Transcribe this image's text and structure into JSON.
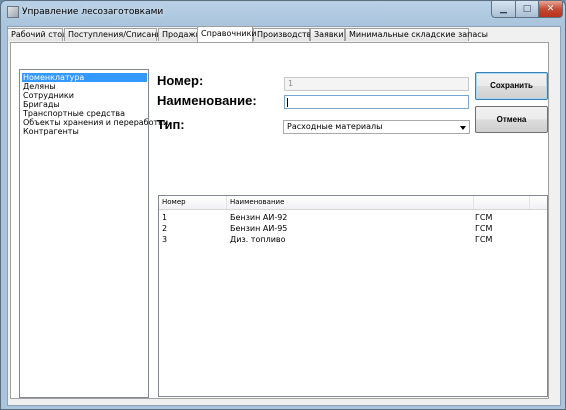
{
  "window": {
    "title": "Управление лесозаготовками",
    "controls": {
      "minimize": "▁",
      "maximize": "□",
      "close": "✕"
    }
  },
  "tabs": [
    {
      "label": "Рабочий стол",
      "active": false
    },
    {
      "label": "Поступления/Списания",
      "active": false
    },
    {
      "label": "Продажи",
      "active": false
    },
    {
      "label": "Справочники",
      "active": true
    },
    {
      "label": "Производство",
      "active": false
    },
    {
      "label": "Заявки",
      "active": false
    },
    {
      "label": "Минимальные складские запасы",
      "active": false
    }
  ],
  "directories": {
    "items": [
      {
        "label": "Номенклатура",
        "selected": true
      },
      {
        "label": "Деляны",
        "selected": false
      },
      {
        "label": "Сотрудники",
        "selected": false
      },
      {
        "label": "Бригады",
        "selected": false
      },
      {
        "label": "Транспортные средства",
        "selected": false
      },
      {
        "label": "Объекты хранения и переработки",
        "selected": false
      },
      {
        "label": "Контрагенты",
        "selected": false
      }
    ]
  },
  "form": {
    "number_label": "Номер:",
    "number_value": "1",
    "name_label": "Наименование:",
    "name_value": "",
    "type_label": "Тип:",
    "type_value": "Расходные материалы"
  },
  "buttons": {
    "save": "Сохранить",
    "cancel": "Отмена"
  },
  "table": {
    "columns": [
      "Номер",
      "Наименование",
      ""
    ],
    "rows": [
      [
        "1",
        "Бензин АИ-92",
        "ГСМ"
      ],
      [
        "2",
        "Бензин АИ-95",
        "ГСМ"
      ],
      [
        "3",
        "Диз. топливо",
        "ГСМ"
      ]
    ]
  },
  "colors": {
    "selection": "#3399ff",
    "title_bar": "#b9d1e6",
    "close_button": "#c44a32"
  }
}
